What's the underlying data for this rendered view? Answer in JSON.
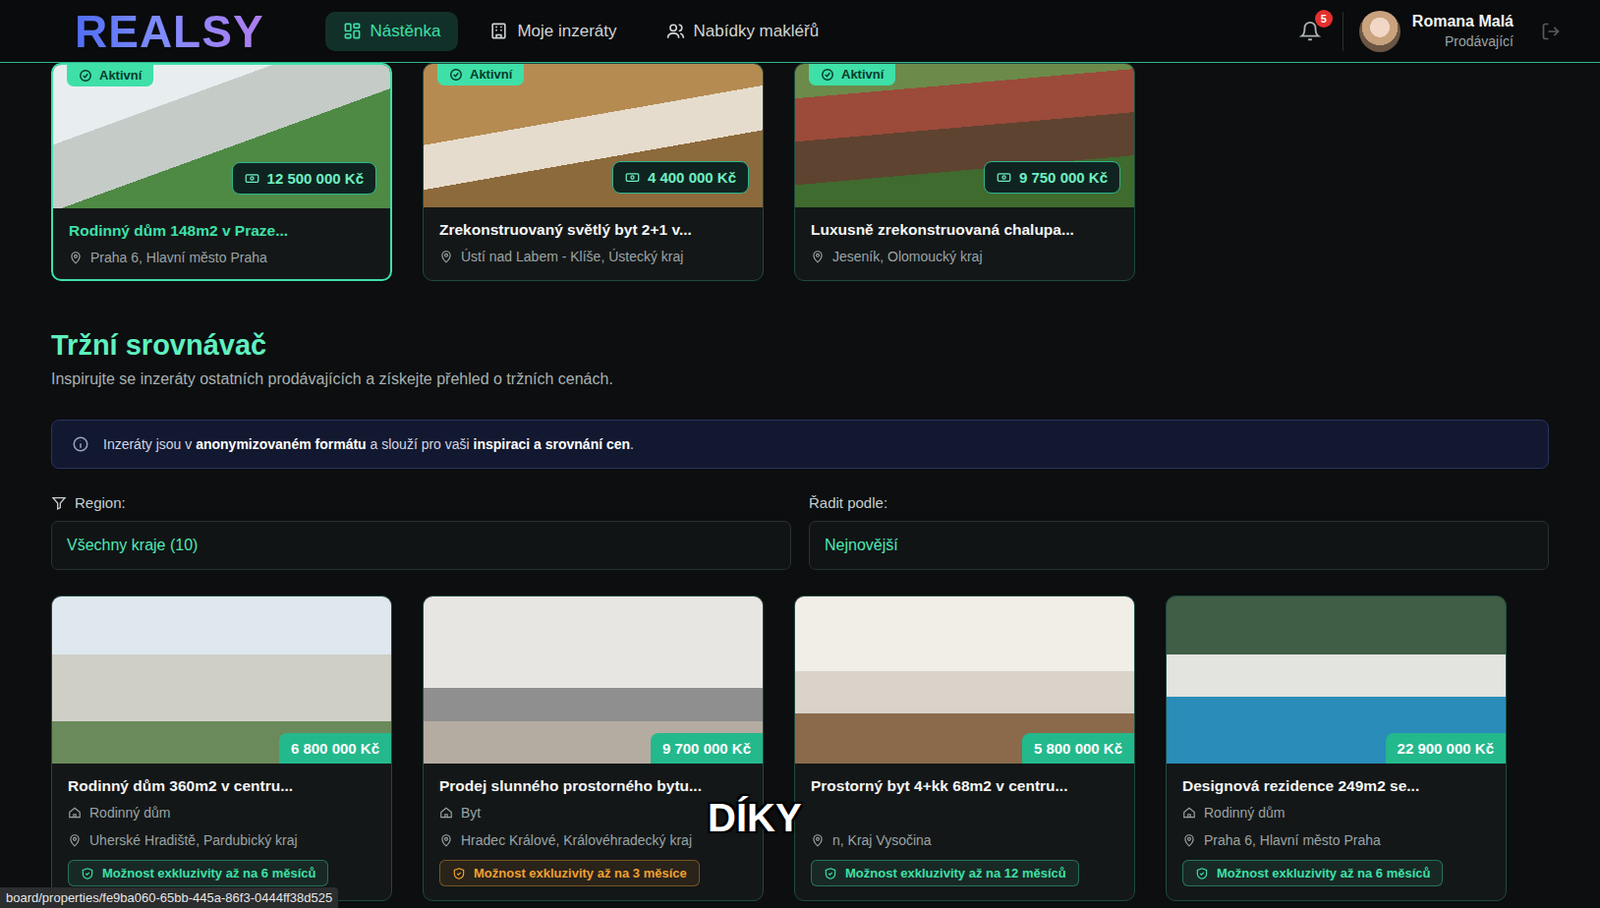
{
  "header": {
    "logo": "REALSY",
    "nav": [
      {
        "label": "Nástěnka",
        "selected": true
      },
      {
        "label": "Moje inzeráty",
        "selected": false
      },
      {
        "label": "Nabídky makléřů",
        "selected": false
      }
    ],
    "notifications": "5",
    "user": {
      "name": "Romana Malá",
      "role": "Prodávající"
    }
  },
  "my_listings": [
    {
      "status": "Aktivní",
      "price": "12 500 000 Kč",
      "title": "Rodinný dům 148m2 v Praze...",
      "location": "Praha 6, Hlavní město Praha",
      "highlighted": true
    },
    {
      "status": "Aktivní",
      "price": "4 400 000 Kč",
      "title": "Zrekonstruovaný světlý byt 2+1 v...",
      "location": "Ústí nad Labem - Klíše, Ústecký kraj",
      "highlighted": false
    },
    {
      "status": "Aktivní",
      "price": "9 750 000 Kč",
      "title": "Luxusně zrekonstruovaná chalupa...",
      "location": "Jeseník, Olomoucký kraj",
      "highlighted": false
    }
  ],
  "market": {
    "title": "Tržní srovnávač",
    "subtitle": "Inspirujte se inzeráty ostatních prodávajících a získejte přehled o tržních cenách.",
    "notice": [
      {
        "text": "Inzeráty jsou v ",
        "bold": false
      },
      {
        "text": "anonymizovaném formátu",
        "bold": true
      },
      {
        "text": " a slouží pro vaši ",
        "bold": false
      },
      {
        "text": "inspiraci a srovnání cen",
        "bold": true
      },
      {
        "text": ".",
        "bold": false
      }
    ],
    "filters": [
      {
        "label": "Region:",
        "value": "Všechny kraje (10)",
        "kind": "filter"
      },
      {
        "label": "Řadit podle:",
        "value": "Nejnovější",
        "kind": "sort"
      }
    ],
    "listings": [
      {
        "price": "6 800 000 Kč",
        "title": "Rodinný dům 360m2 v centru...",
        "type": "Rodinný dům",
        "location": "Uherské Hradiště, Pardubický kraj",
        "badge": "Možnost exkluzivity až na 6 měsíců",
        "color": "#3ee0a8"
      },
      {
        "price": "9 700 000 Kč",
        "title": "Prodej slunného prostorného bytu...",
        "type": "Byt",
        "location": "Hradec Králové, Královéhradecký kraj",
        "badge": "Možnost exkluzivity až na 3 měsíce",
        "color": "#f0a030"
      },
      {
        "price": "5 800 000 Kč",
        "title": "Prostorný byt 4+kk 68m2 v centru...",
        "location": "n, Kraj Vysočina",
        "badge": "Možnost exkluzivity až na 12 měsíců",
        "color": "#3ee0a8"
      },
      {
        "price": "22 900 000 Kč",
        "title": "Designová rezidence 249m2 se...",
        "type": "Rodinný dům",
        "location": "Praha 6, Hlavní město Praha",
        "badge": "Možnost exkluzivity až na 6 měsíců",
        "color": "#3ee0a8"
      }
    ]
  },
  "caption": "DÍKY",
  "status_url": "board/properties/fe9ba060-65bb-445a-86f3-0444ff38d525"
}
